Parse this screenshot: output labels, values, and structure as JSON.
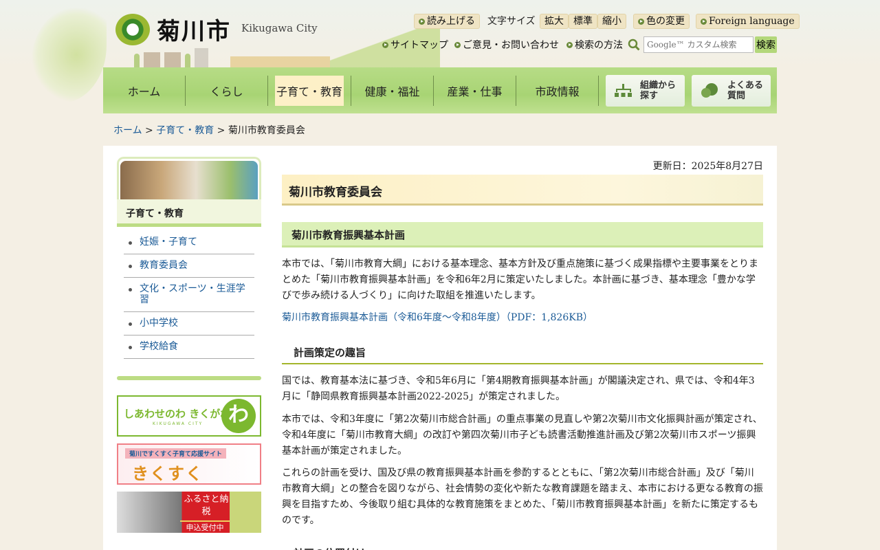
{
  "header": {
    "logo_text": "菊川市",
    "logo_en": "Kikugawa City",
    "tools": {
      "read_aloud": "読み上げる",
      "text_size_label": "文字サイズ",
      "enlarge": "拡大",
      "standard": "標準",
      "shrink": "縮小",
      "color_change": "色の変更",
      "foreign": "Foreign language"
    },
    "links": {
      "sitemap": "サイトマップ",
      "contact": "ご意見・お問い合わせ",
      "search_help": "検索の方法"
    },
    "search": {
      "placeholder": "Google™ カスタム検索",
      "button": "検索"
    }
  },
  "nav": {
    "items": [
      "ホーム",
      "くらし",
      "子育て・教育",
      "健康・福祉",
      "産業・仕事",
      "市政情報"
    ],
    "active": "子育て・教育",
    "org_search": [
      "組織から",
      "探す"
    ],
    "faq": [
      "よくある",
      "質問"
    ]
  },
  "breadcrumb": {
    "home": "ホーム",
    "parent": "子育て・教育",
    "current": "菊川市教育委員会"
  },
  "sidebar": {
    "title": "子育て・教育",
    "items": [
      "妊娠・子育て",
      "教育委員会",
      "文化・スポーツ・生涯学習",
      "小中学校",
      "学校給食"
    ],
    "banners": {
      "b1": {
        "title": "しあわせのわ きくがわ",
        "sub": "KIKUGAWA CITY",
        "mark": "わ"
      },
      "b2": {
        "title": "菊川ですくすく子育て応援サイト",
        "sub": "きくすく"
      },
      "b3": {
        "title": "ふるさと納税",
        "sub": "申込受付中"
      }
    }
  },
  "content": {
    "updated": "更新日：2025年8月27日",
    "title": "菊川市教育委員会",
    "section1": {
      "heading": "菊川市教育振興基本計画",
      "text": "本市では、「菊川市教育大綱」における基本理念、基本方針及び重点施策に基づく成果指標や主要事業をとりまとめた「菊川市教育振興基本計画」を令和6年2月に策定いたしました。本計画に基づき、基本理念「豊かな学びで歩み続ける人づくり」に向けた取組を推進いたします。",
      "link": "菊川市教育振興基本計画（令和6年度〜令和8年度）（PDF：1,826KB）"
    },
    "section2": {
      "heading": "計画策定の趣旨",
      "p1": "国では、教育基本法に基づき、令和5年6月に「第4期教育振興基本計画」が閣議決定され、県では、令和4年3月に「静岡県教育振興基本計画2022-2025」が策定されました。",
      "p2": "本市では、令和3年度に「第2次菊川市総合計画」の重点事業の見直しや第2次菊川市文化振興計画が策定され、令和4年度に「菊川市教育大綱」の改訂や第四次菊川市子ども読書活動推進計画及び第2次菊川市スポーツ振興基本計画が策定されました。",
      "p3": "これらの計画を受け、国及び県の教育振興基本計画を参酌するとともに、「第2次菊川市総合計画」及び「菊川市教育大綱」との整合を図りながら、社会情勢の変化や新たな教育課題を踏まえ、本市における更なる教育の振興を目指すため、今後取り組む具体的な教育施策をまとめた、「菊川市教育振興基本計画」を新たに策定するものです。"
    },
    "section3": {
      "heading": "計画の位置付け"
    }
  }
}
